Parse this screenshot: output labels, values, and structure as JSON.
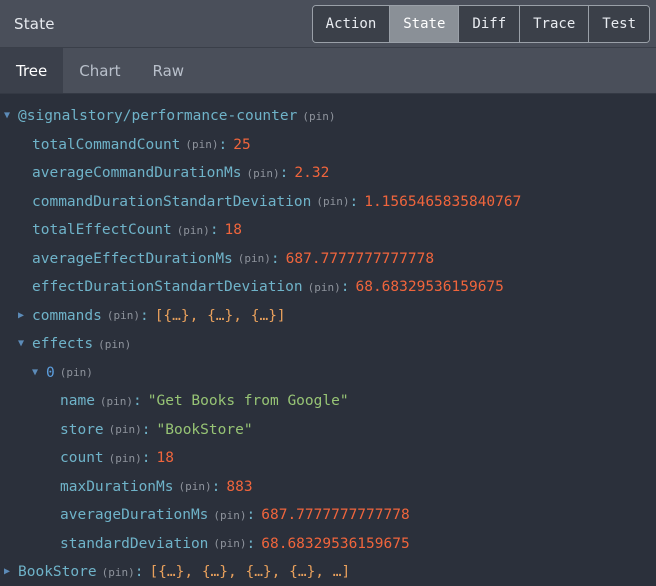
{
  "header": {
    "title": "State",
    "segments": [
      {
        "label": "Action",
        "active": false
      },
      {
        "label": "State",
        "active": true
      },
      {
        "label": "Diff",
        "active": false
      },
      {
        "label": "Trace",
        "active": false
      },
      {
        "label": "Test",
        "active": false
      }
    ]
  },
  "tabs": [
    {
      "label": "Tree",
      "active": true
    },
    {
      "label": "Chart",
      "active": false
    },
    {
      "label": "Raw",
      "active": false
    }
  ],
  "pin_label": "(pin)",
  "colon": ":",
  "arrow_expanded": "▼",
  "arrow_collapsed": "▶",
  "colors": {
    "background": "#2b303b",
    "header_background": "#4a4f5a",
    "tab_active_background": "#3b404b",
    "segment_active_background": "#8a9097",
    "key": "#6fb3c9",
    "index_key": "#5c9ede",
    "number": "#f0653c",
    "string": "#97c475",
    "array_preview": "#e8a05c",
    "pin": "#8e939c",
    "arrow": "#5c8bb8"
  },
  "tree": [
    {
      "level": 0,
      "arrow": "expanded",
      "key": "@signalstory/performance-counter",
      "value": "",
      "value_type": "none"
    },
    {
      "level": 1,
      "arrow": "none",
      "key": "totalCommandCount",
      "value": "25",
      "value_type": "number"
    },
    {
      "level": 1,
      "arrow": "none",
      "key": "averageCommandDurationMs",
      "value": "2.32",
      "value_type": "number"
    },
    {
      "level": 1,
      "arrow": "none",
      "key": "commandDurationStandartDeviation",
      "value": "1.1565465835840767",
      "value_type": "number"
    },
    {
      "level": 1,
      "arrow": "none",
      "key": "totalEffectCount",
      "value": "18",
      "value_type": "number"
    },
    {
      "level": 1,
      "arrow": "none",
      "key": "averageEffectDurationMs",
      "value": "687.7777777777778",
      "value_type": "number"
    },
    {
      "level": 1,
      "arrow": "none",
      "key": "effectDurationStandartDeviation",
      "value": "68.68329536159675",
      "value_type": "number"
    },
    {
      "level": 1,
      "arrow": "collapsed",
      "key": "commands",
      "value": "[{…}, {…}, {…}]",
      "value_type": "array"
    },
    {
      "level": 1,
      "arrow": "expanded",
      "key": "effects",
      "value": "",
      "value_type": "none"
    },
    {
      "level": 2,
      "arrow": "expanded",
      "key": "0",
      "value": "",
      "value_type": "none",
      "key_style": "index"
    },
    {
      "level": 3,
      "arrow": "none",
      "key": "name",
      "value": "\"Get Books from Google\"",
      "value_type": "string"
    },
    {
      "level": 3,
      "arrow": "none",
      "key": "store",
      "value": "\"BookStore\"",
      "value_type": "string"
    },
    {
      "level": 3,
      "arrow": "none",
      "key": "count",
      "value": "18",
      "value_type": "number"
    },
    {
      "level": 3,
      "arrow": "none",
      "key": "maxDurationMs",
      "value": "883",
      "value_type": "number"
    },
    {
      "level": 3,
      "arrow": "none",
      "key": "averageDurationMs",
      "value": "687.7777777777778",
      "value_type": "number"
    },
    {
      "level": 3,
      "arrow": "none",
      "key": "standardDeviation",
      "value": "68.68329536159675",
      "value_type": "number"
    },
    {
      "level": 0,
      "arrow": "collapsed",
      "key": "BookStore",
      "value": "[{…}, {…}, {…}, {…}, …]",
      "value_type": "array"
    }
  ]
}
